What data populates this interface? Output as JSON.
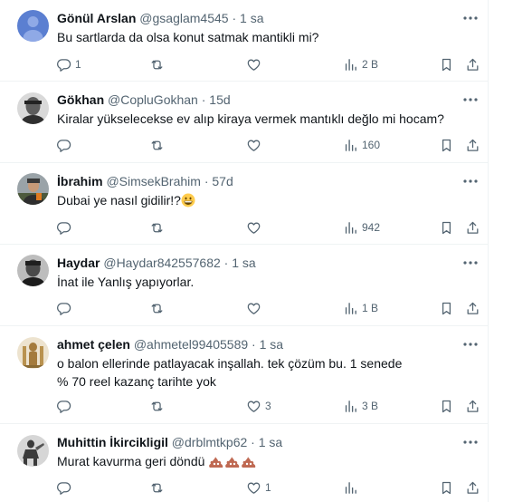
{
  "tweets": [
    {
      "name": "Gönül Arslan",
      "handle": "@gsaglam4545",
      "separator": "·",
      "time": "1 sa",
      "text": "Bu sartlarda da olsa konut satmak mantikli mi?",
      "emojis": "",
      "replies": "1",
      "retweets": "",
      "likes": "",
      "views": "2 B",
      "avatar": "default-avatar"
    },
    {
      "name": "Gökhan",
      "handle": "@CopluGokhan",
      "separator": "·",
      "time": "15d",
      "text": "Kiralar yükselecekse ev alıp kiraya vermek mantıklı değlo mi hocam?",
      "emojis": "",
      "replies": "",
      "retweets": "",
      "likes": "",
      "views": "160",
      "avatar": "portrait-avatar"
    },
    {
      "name": "İbrahim",
      "handle": "@SimsekBrahim",
      "separator": "·",
      "time": "57d",
      "text": "Dubai ye nasıl gidilir!?",
      "emojis": "grinning-face-emoji",
      "replies": "",
      "retweets": "",
      "likes": "",
      "views": "942",
      "avatar": "photo-avatar"
    },
    {
      "name": "Haydar",
      "handle": "@Haydar842557682",
      "separator": "·",
      "time": "1 sa",
      "text": "İnat ile Yanlış yapıyorlar.",
      "emojis": "",
      "replies": "",
      "retweets": "",
      "likes": "",
      "views": "1 B",
      "avatar": "portrait-avatar"
    },
    {
      "name": "ahmet çelen",
      "handle": "@ahmetel99405589",
      "separator": "·",
      "time": "1 sa",
      "text": "o balon ellerinde patlayacak inşallah.  tek çözüm bu. 1 senede % 70 reel kazanç tarihte yok",
      "emojis": "",
      "replies": "",
      "retweets": "",
      "likes": "3",
      "views": "3 B",
      "avatar": "statue-avatar"
    },
    {
      "name": "Muhittin İkircikligil",
      "handle": "@drblmtkp62",
      "separator": "·",
      "time": "1 sa",
      "text": "Murat kavurma geri döndü ",
      "emojis": "pile-of-poo-emoji x3",
      "replies": "",
      "retweets": "",
      "likes": "1",
      "views": "",
      "avatar": "statue-avatar"
    }
  ],
  "colors": {
    "text": "#0f1419",
    "secondary": "#536471",
    "border": "#eff3f4",
    "default_avatar": "#5b7fd1"
  }
}
